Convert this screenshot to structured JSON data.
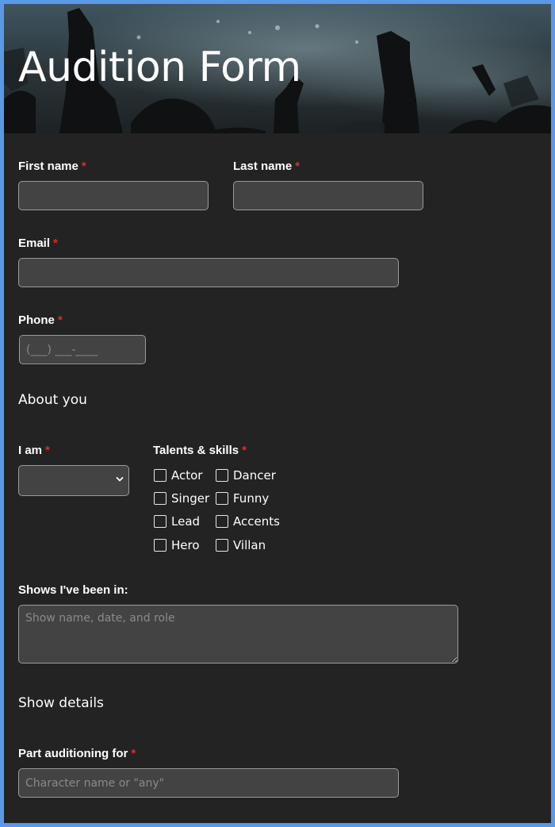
{
  "banner": {
    "title": "Audition Form"
  },
  "fields": {
    "first_name": {
      "label": "First name",
      "required": "*",
      "value": ""
    },
    "last_name": {
      "label": "Last name",
      "required": "*",
      "value": ""
    },
    "email": {
      "label": "Email",
      "required": "*",
      "value": ""
    },
    "phone": {
      "label": "Phone",
      "required": "*",
      "placeholder": "(___) ___-____"
    }
  },
  "about": {
    "heading": "About you",
    "i_am": {
      "label": "I am",
      "required": "*",
      "selected": ""
    },
    "talents": {
      "label": "Talents & skills",
      "required": "*",
      "options": [
        "Actor",
        "Dancer",
        "Singer",
        "Funny",
        "Lead",
        "Accents",
        "Hero",
        "Villan"
      ]
    },
    "shows": {
      "label": "Shows I've been in:",
      "placeholder": "Show name, date, and role"
    }
  },
  "show_details": {
    "heading": "Show details",
    "part": {
      "label": "Part auditioning for",
      "required": "*",
      "placeholder": "Character name or \"any\""
    }
  },
  "colors": {
    "page_background": "#232323",
    "border_accent": "#5b98e6",
    "required_marker": "#e12b2b",
    "field_background": "#434343"
  },
  "icons": {
    "select_arrow": "chevron-down-icon",
    "checkbox": "checkbox-unchecked-icon"
  }
}
